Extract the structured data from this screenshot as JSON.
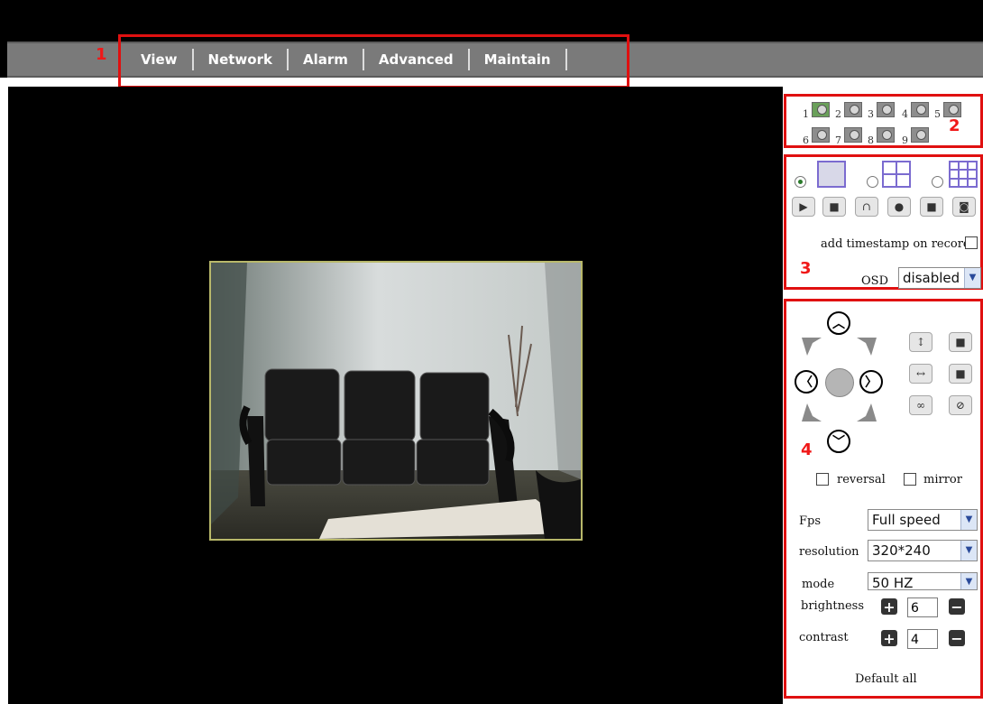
{
  "menu": {
    "items": [
      "View",
      "Network",
      "Alarm",
      "Advanced",
      "Maintain"
    ]
  },
  "annotations": [
    "1",
    "2",
    "3",
    "4"
  ],
  "cameras": {
    "labels": [
      "1",
      "2",
      "3",
      "4",
      "5",
      "6",
      "7",
      "8",
      "9"
    ],
    "active_index": 0
  },
  "layout_section": {
    "timestamp_label": "add timestamp on record",
    "osd_label": "OSD",
    "osd_value": "disabled"
  },
  "ptz": {
    "reversal_label": "reversal",
    "mirror_label": "mirror",
    "fps_label": "Fps",
    "fps_value": "Full speed",
    "resolution_label": "resolution",
    "resolution_value": "320*240",
    "mode_label": "mode",
    "mode_value": "50 HZ",
    "brightness_label": "brightness",
    "brightness_value": "6",
    "contrast_label": "contrast",
    "contrast_value": "4",
    "default_all_label": "Default all"
  },
  "colors": {
    "accent_red": "#e01010",
    "menubar_gray": "#7a7a7a"
  }
}
